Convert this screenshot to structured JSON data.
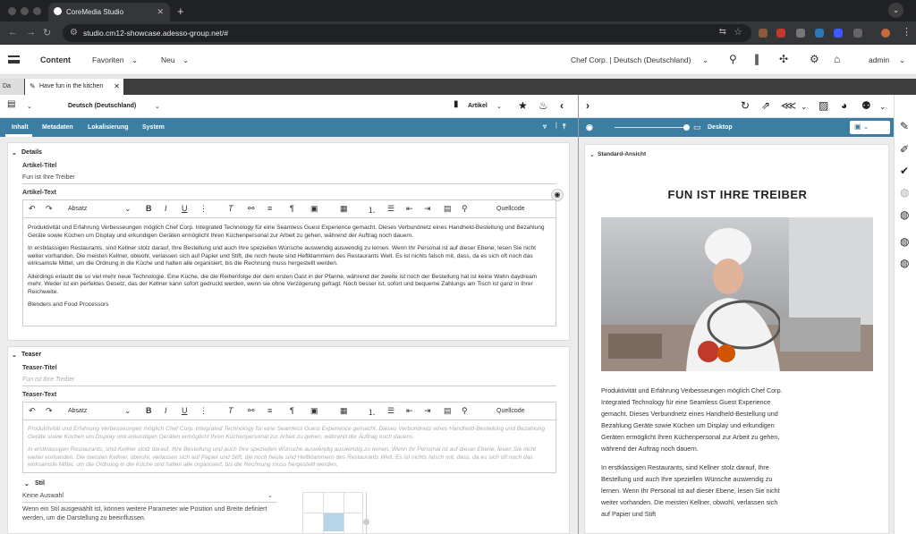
{
  "browser": {
    "tab_title": "CoreMedia Studio",
    "tab_close": "✕",
    "new_tab": "+",
    "url": "studio.cm12-showcase.adesso-group.net/#"
  },
  "app_header": {
    "content": "Content",
    "favoriten": "Favoriten",
    "neu": "Neu",
    "site": "Chef Corp. | Deutsch (Deutschland)",
    "user": "admin"
  },
  "doc_tabs": [
    {
      "label": "Da"
    },
    {
      "label": "Have fun in the kitchen"
    }
  ],
  "left_toolbar": {
    "language": "Deutsch (Deutschland)",
    "doctype": "Artikel"
  },
  "subtabs": [
    "Inhalt",
    "Metadaten",
    "Lokalisierung",
    "System"
  ],
  "details": {
    "section": "Details",
    "title_label": "Artikel-Titel",
    "title_value": "Fun ist Ihre Treiber",
    "text_label": "Artikel-Text",
    "paragraphs": [
      "Produktivität und Erfahrung Verbesseungen möglich Chef Corp. Integrated Technology für eine Seamless Guest Experience gemacht. Dieses Verbundnetz eines Handheld-Bestellung und Bezahlung Geräte sowie Küchen um Display und erkundigen Geräten ermöglicht Ihren Küchenpersonal zur Arbeit zu gehen, während der Auftrag noch dauern.",
      "In erstklassigen Restaurants, sind Kellner stolz darauf, Ihre Bestellung und auch Ihre speziellen Wünsche auswendig auswendig zu lernen. Wenn Ihr Personal ist auf dieser Ebene, lesen Sie nicht weiter vorhanden. Die meisten Kellner, obwohl, verlassen sich auf Papier und Stift, die noch heute sind Heftklammern des Restaurants Welt. Es ist nichts falsch mit, dass, da es sich oft noch das wirksamste Mittel, um die Ordnung in die Küche und halten alle organisiert, bis die Rechnung muss hergestellt werden.",
      "Allerdings erlaubt die so viel mehr neue Technologie. Eine Küche, die die Reihenfolge der dem ersten Gast in der Pfanne, während der zweite ist noch der Bestellung hat ist keine Wahn daydream mehr. Weder ist ein perfektes Gesetz, das der Kellner kann sofort gedruckt werden, wenn sie ohne Verzögerung gefragt. Noch besser ist, sofort und bequeme Zahlungs am Tisch ist ganz in Ihrer Reichweite.",
      "Blenders and Food Processors"
    ]
  },
  "teaser": {
    "section": "Teaser",
    "title_label": "Teaser-Titel",
    "title_value": "Fun ist Ihre Treiber",
    "text_label": "Teaser-Text",
    "paragraphs": [
      "Produktivität und Erfahrung Verbesseungen möglich Chef Corp. Integrated Technology für eine Seamless Guest Experience gemacht. Dieses Verbundnetz eines Handheld-Bestellung und Bezahlung Geräte sowie Küchen um Display und erkundigen Geräten ermöglicht Ihren Küchenpersonal zur Arbeit zu gehen, während der Auftrag noch dauern.",
      "In erstklassigen Restaurants, sind Kellner stolz darauf, Ihre Bestellung und auch Ihre speziellen Wünsche auswendig auswendig zu lernen. Wenn Ihr Personal ist auf dieser Ebene, lesen Sie nicht weiter vorhanden. Die meisten Kellner, obwohl, verlassen sich auf Papier und Stift, die noch heute sind Heftklammern des Restaurants Welt. Es ist nichts falsch mit, dass, da es sich oft noch das wirksamste Mittel, um die Ordnung in die Küche und halten alle organisiert, bis die Rechnung muss hergestellt werden."
    ]
  },
  "stil": {
    "label": "Stil",
    "select_value": "Keine Auswahl",
    "help": "Wenn ein Stil ausgewählt ist, können weitere Parameter wie Position und Breite definiert werden, um die Darstellung zu beeinflussen."
  },
  "rte_toolbar": {
    "paragraph_style": "Absatz",
    "source": "Quellcode"
  },
  "preview": {
    "device": "Desktop",
    "view_label": "Standard-Ansicht",
    "headline": "FUN IST IHRE TREIBER",
    "paragraphs": [
      "Produktivität und Erfahrung Verbesseungen möglich Chef Corp. Integrated Technology für eine Seamless Guest Experience gemacht. Dieses Verbundnetz eines Handheld-Bestellung und Bezahlung Geräte sowie Küchen um Display und erkundigen Geräten ermöglicht Ihren Küchenpersonal zur Arbeit zu gehen, während der Auftrag noch dauern.",
      "In erstklassigen Restaurants, sind Kellner stolz darauf, Ihre Bestellung und auch Ihre speziellen Wünsche auswendig zu lernen. Wenn Ihr Personal ist auf dieser Ebene, lesen Sie nicht weiter vorhanden. Die meisten Kellner, obwohl, verlassen sich auf Papier und Stift"
    ]
  },
  "colors": {
    "accent": "#3b7ea1",
    "chrome_dark": "#202124"
  }
}
